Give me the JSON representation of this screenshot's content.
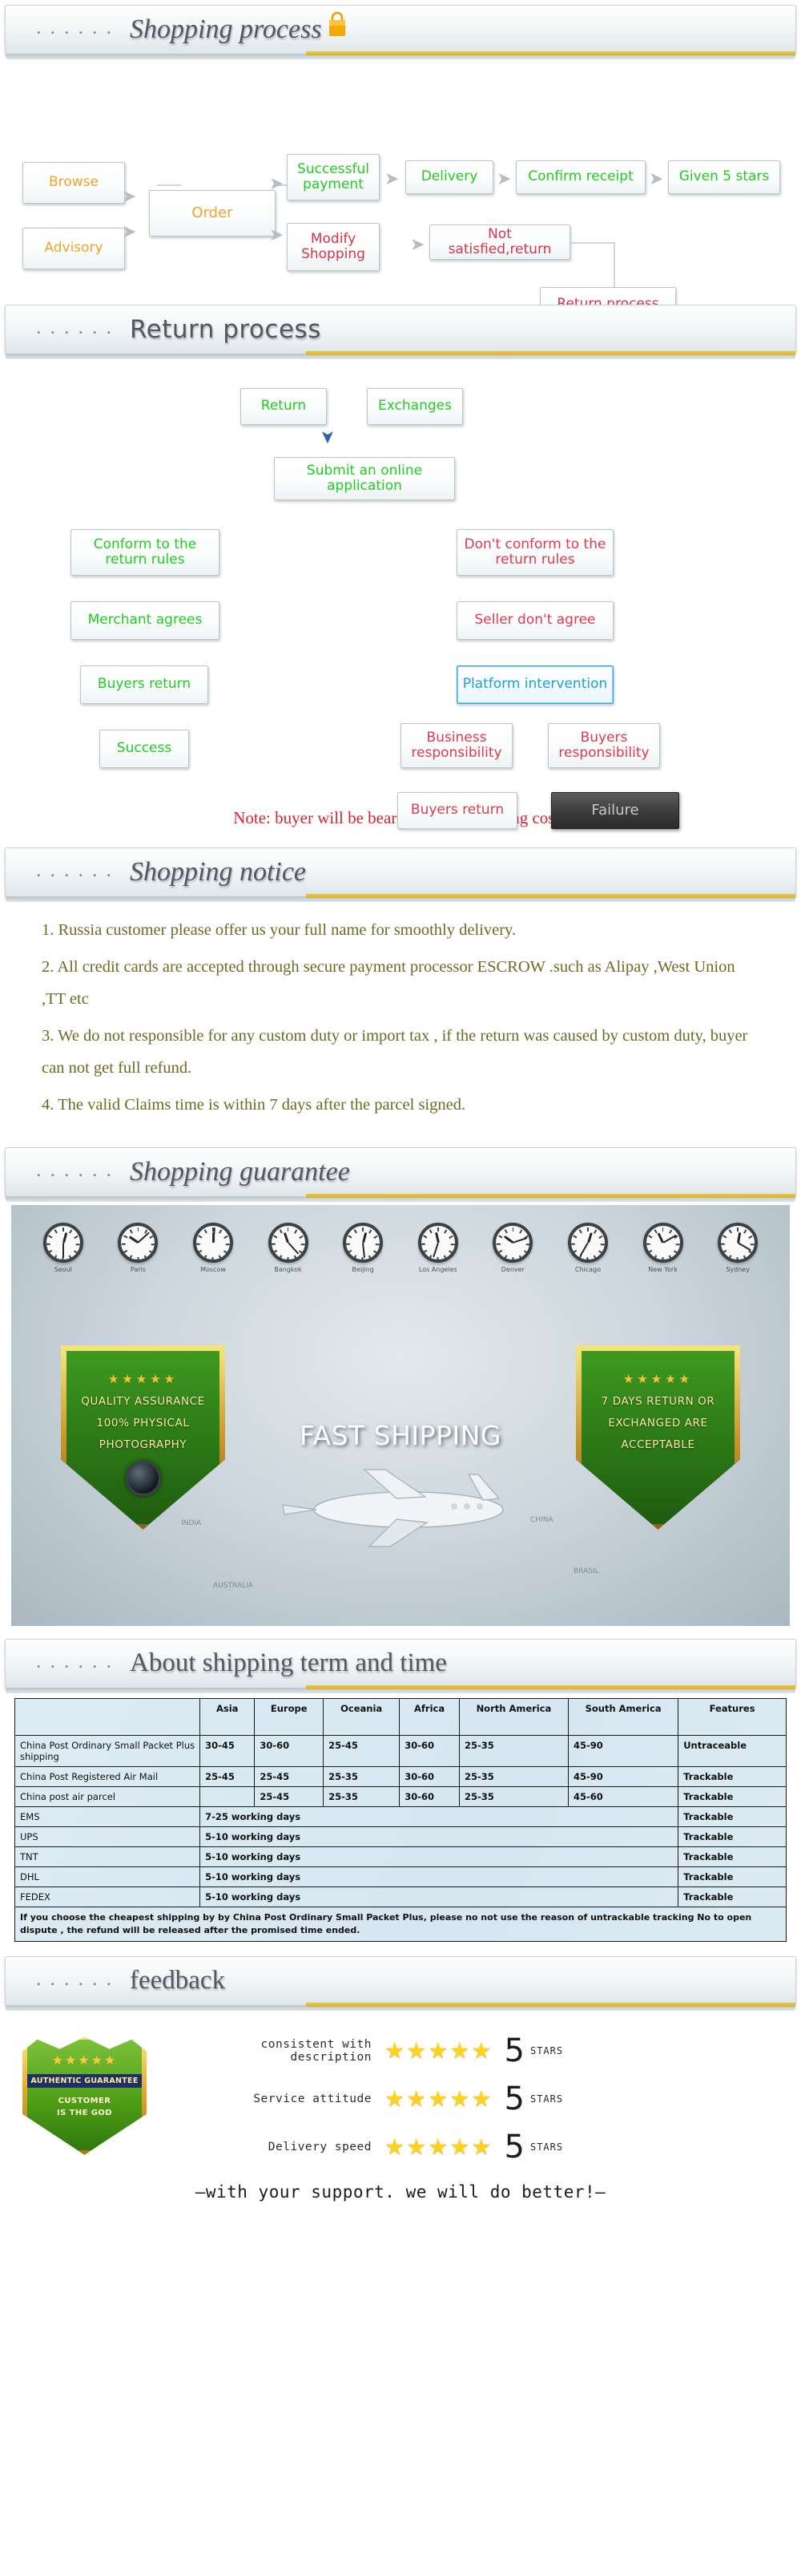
{
  "sections": {
    "shopping_process": {
      "dots": "......",
      "title": "Shopping process",
      "icon": "shopping-bag-icon"
    },
    "return_process": {
      "dots": "......",
      "title": "Return process"
    },
    "shopping_notice": {
      "dots": "......",
      "title": "Shopping notice"
    },
    "shopping_guarantee": {
      "dots": "......",
      "title": "Shopping guarantee"
    },
    "shipping_term": {
      "dots": "......",
      "title": "About shipping term and time"
    },
    "feedback": {
      "dots": "......",
      "title": "feedback"
    }
  },
  "shopping_flow": {
    "browse": "Browse",
    "advisory": "Advisory",
    "order": "Order",
    "successful_payment": "Successful payment",
    "modify_shopping": "Modify Shopping",
    "delivery": "Delivery",
    "confirm_receipt": "Confirm receipt",
    "given_5_stars": "Given 5 stars",
    "not_satisfied_return": "Not satisfied,return",
    "return_process": "Return process"
  },
  "return_flow": {
    "return": "Return",
    "exchanges": "Exchanges",
    "submit_online": "Submit an online application",
    "conform": "Conform to the return rules",
    "not_conform": "Don't conform to the return rules",
    "merchant_agrees": "Merchant agrees",
    "seller_disagree": "Seller don't agree",
    "buyers_return_left": "Buyers return",
    "platform_intervention": "Platform intervention",
    "success": "Success",
    "business_responsibility": "Business responsibility",
    "buyers_responsibility": "Buyers responsibility",
    "buyers_return_right": "Buyers return",
    "failure": "Failure",
    "note": "Note: buyer will be bear the return shipping cost.."
  },
  "notice_items": [
    "1. Russia customer please offer us your full name for smoothly delivery.",
    "2. All credit cards are accepted through secure payment processor ESCROW .such as Alipay ,West Union ,TT etc",
    "3. We do not responsible for any custom duty or import tax , if the return was caused by custom duty,  buyer can not get full refund.",
    "4. The valid Claims time is within 7 days after the parcel signed."
  ],
  "guarantee": {
    "clocks": [
      {
        "city": "Seoul",
        "hour": 12,
        "minute": 30
      },
      {
        "city": "Paris",
        "hour": 10,
        "minute": 8
      },
      {
        "city": "Moscow",
        "hour": 12,
        "minute": 1
      },
      {
        "city": "Bangkok",
        "hour": 11,
        "minute": 23
      },
      {
        "city": "Beijing",
        "hour": 12,
        "minute": 29
      },
      {
        "city": "Los Angeles",
        "hour": 11,
        "minute": 33
      },
      {
        "city": "Denver",
        "hour": 10,
        "minute": 12
      },
      {
        "city": "Chicago",
        "hour": 12,
        "minute": 35
      },
      {
        "city": "New York",
        "hour": 11,
        "minute": 10
      },
      {
        "city": "Sydney",
        "hour": 12,
        "minute": 20
      }
    ],
    "left_shield": {
      "stars": "★★★★★",
      "line1": "QUALITY ASSURANCE",
      "line2": "100%  PHYSICAL",
      "line3": "PHOTOGRAPHY",
      "icon": "camera-lens-icon"
    },
    "right_shield": {
      "stars": "★★★★★",
      "line1": "7 DAYS RETURN OR",
      "line2": "EXCHANGED ARE",
      "line3": "ACCEPTABLE"
    },
    "fast_shipping": "FAST SHIPPING",
    "map_labels": [
      "INDIA",
      "CHINA",
      "BRASIL",
      "AUSTRALIA"
    ]
  },
  "shipping_table": {
    "columns": [
      "",
      "Asia",
      "Europe",
      "Oceania",
      "Africa",
      "North America",
      "South America",
      "Features"
    ],
    "rows": [
      {
        "label": "China Post Ordinary Small Packet Plus shipping",
        "cells": [
          "30-45",
          "30-60",
          "25-45",
          "30-60",
          "25-35",
          "45-90"
        ],
        "feature": "Untraceable"
      },
      {
        "label": "China Post Registered Air Mail",
        "cells": [
          "25-45",
          "25-45",
          "25-35",
          "30-60",
          "25-35",
          "45-90"
        ],
        "feature": "Trackable"
      },
      {
        "label": "China post air parcel",
        "cells": [
          "",
          "25-45",
          "25-35",
          "30-60",
          "25-35",
          "45-60"
        ],
        "feature": "Trackable"
      },
      {
        "label": "EMS",
        "span": "7-25 working days",
        "feature": "Trackable"
      },
      {
        "label": "UPS",
        "span": "5-10 working days",
        "feature": "Trackable"
      },
      {
        "label": "TNT",
        "span": "5-10 working days",
        "feature": "Trackable"
      },
      {
        "label": "DHL",
        "span": "5-10 working days",
        "feature": "Trackable"
      },
      {
        "label": "FEDEX",
        "span": "5-10 working days",
        "feature": "Trackable"
      }
    ],
    "footnote": "If you choose the cheapest shipping by by China Post Ordinary Small Packet Plus, please no not use the reason of untrackable tracking No to open dispute , the refund will be released after the promised time ended."
  },
  "feedback": {
    "badge": {
      "stars": "★★★★★",
      "banner": "AUTHENTIC GUARANTEE",
      "line1": "CUSTOMER",
      "line2": "IS THE GOD"
    },
    "rows": [
      {
        "label": "consistent with description",
        "stars": "★★★★★",
        "score": "5",
        "unit": "STARS"
      },
      {
        "label": "Service attitude",
        "stars": "★★★★★",
        "score": "5",
        "unit": "STARS"
      },
      {
        "label": "Delivery speed",
        "stars": "★★★★★",
        "score": "5",
        "unit": "STARS"
      }
    ],
    "support": "—with your support. we will do better!—"
  }
}
